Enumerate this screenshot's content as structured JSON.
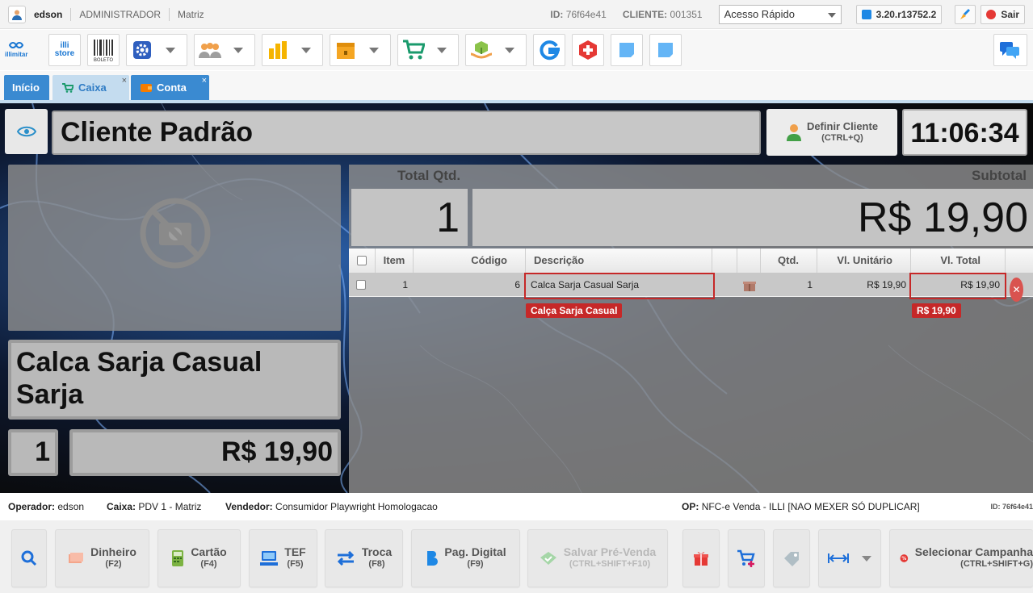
{
  "topbar": {
    "user": "edson",
    "role": "ADMINISTRADOR",
    "store": "Matriz",
    "id_label": "ID:",
    "id_value": "76f64e41",
    "client_label": "CLIENTE:",
    "client_value": "001351",
    "quick_access": "Acesso Rápido",
    "version": "3.20.r13752.2",
    "logout": "Sair"
  },
  "toolbar": {
    "logo": "illimitar",
    "store_logo": "illi store",
    "boleto": "BOLETO"
  },
  "tabs": [
    {
      "label": "Início"
    },
    {
      "label": "Caixa",
      "close": "×"
    },
    {
      "label": "Conta",
      "close": "×"
    }
  ],
  "header": {
    "client_name": "Cliente Padrão",
    "define_client": "Definir Cliente",
    "define_client_shortcut": "(CTRL+Q)",
    "clock": "11:06:34"
  },
  "product": {
    "name": "Calca Sarja Casual Sarja",
    "qty": "1",
    "price": "R$ 19,90"
  },
  "totals": {
    "qty_label": "Total Qtd.",
    "qty_value": "1",
    "subtotal_label": "Subtotal",
    "subtotal_value": "R$ 19,90"
  },
  "grid": {
    "columns": {
      "item": "Item",
      "code": "Código",
      "description": "Descrição",
      "qty": "Qtd.",
      "unit": "Vl. Unitário",
      "total": "Vl. Total"
    },
    "rows": [
      {
        "item": "1",
        "code": "6",
        "description": "Calca Sarja Casual Sarja",
        "qty": "1",
        "unit": "R$ 19,90",
        "total": "R$ 19,90"
      }
    ],
    "desc_tooltip": "Calça Sarja Casual",
    "total_tooltip": "R$ 19,90"
  },
  "status": {
    "operator_label": "Operador:",
    "operator": "edson",
    "cashier_label": "Caixa:",
    "cashier": "PDV 1 - Matriz",
    "seller_label": "Vendedor:",
    "seller": "Consumidor Playwright Homologacao",
    "op_label": "OP:",
    "op": "NFC-e Venda - ILLI [NAO MEXER SÓ DUPLICAR]",
    "id": "ID: 76f64e41"
  },
  "buttons": {
    "cash": "Dinheiro",
    "cash_key": "(F2)",
    "card": "Cartão",
    "card_key": "(F4)",
    "tef": "TEF",
    "tef_key": "(F5)",
    "exchange": "Troca",
    "exchange_key": "(F8)",
    "digital": "Pag. Digital",
    "digital_key": "(F9)",
    "presale": "Salvar Pré-Venda",
    "presale_key": "(CTRL+SHIFT+F10)",
    "campaign": "Selecionar Campanha",
    "campaign_key": "(CTRL+SHIFT+G)"
  },
  "colors": {
    "accent": "#3a8ad1",
    "error": "#c62828"
  }
}
